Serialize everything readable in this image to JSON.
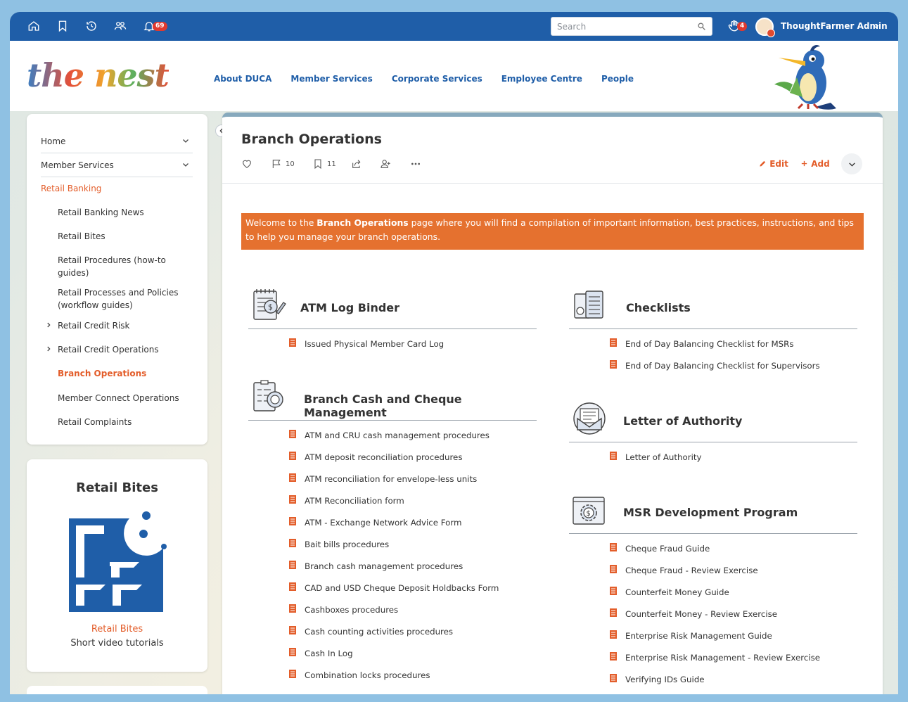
{
  "topbar": {
    "notifications_count": "69",
    "high_five_count": "4",
    "search_placeholder": "Search",
    "user_name": "ThoughtFarmer Admin"
  },
  "header": {
    "logo_text": "the nest",
    "nav": [
      "About DUCA",
      "Member Services",
      "Corporate Services",
      "Employee Centre",
      "People"
    ]
  },
  "sidebar": {
    "top_items": [
      "Home",
      "Member Services"
    ],
    "active_item": "Retail Banking",
    "sub_items": [
      {
        "label": "Retail Banking News",
        "arrow": false
      },
      {
        "label": "Retail Bites",
        "arrow": false
      },
      {
        "label": "Retail Procedures (how-to guides)",
        "arrow": false
      },
      {
        "label": "Retail Processes and Policies (workflow guides)",
        "arrow": false
      },
      {
        "label": "Retail Credit Risk",
        "arrow": true
      },
      {
        "label": "Retail Credit Operations",
        "arrow": true
      },
      {
        "label": "Branch Operations",
        "arrow": false
      },
      {
        "label": "Member Connect Operations",
        "arrow": false
      },
      {
        "label": "Retail Complaints",
        "arrow": false
      }
    ]
  },
  "retail_bites_card": {
    "title": "Retail Bites",
    "link": "Retail Bites",
    "subtitle": "Short video tutorials"
  },
  "main": {
    "title": "Branch Operations",
    "comments_count": "10",
    "bookmarks_count": "11",
    "edit_label": "Edit",
    "add_label": "Add",
    "banner_pre": "Welcome to the ",
    "banner_bold": "Branch Operations",
    "banner_post": " page where you will find a compilation of important information, best practices, instructions, and tips to help you manage your branch operations."
  },
  "sections_left": [
    {
      "title": "ATM Log Binder",
      "items": [
        "Issued Physical Member Card Log"
      ]
    },
    {
      "title": "Branch Cash and Cheque Management",
      "items": [
        "ATM and CRU cash management procedures",
        "ATM deposit reconciliation procedures",
        "ATM reconciliation for envelope-less units",
        "ATM Reconciliation form",
        "ATM - Exchange Network Advice Form",
        "Bait bills procedures",
        "Branch cash management procedures",
        "CAD and USD Cheque Deposit Holdbacks Form",
        "Cashboxes procedures",
        "Cash counting activities procedures",
        "Cash In Log",
        "Combination locks procedures"
      ]
    }
  ],
  "sections_right": [
    {
      "title": "Checklists",
      "items": [
        "End of Day Balancing Checklist for MSRs",
        "End of Day Balancing Checklist for Supervisors"
      ]
    },
    {
      "title": "Letter of Authority",
      "items": [
        "Letter of Authority"
      ]
    },
    {
      "title": "MSR Development Program",
      "items": [
        "Cheque Fraud Guide",
        "Cheque Fraud - Review Exercise",
        "Counterfeit Money Guide",
        "Counterfeit Money - Review Exercise",
        "Enterprise Risk Management Guide",
        "Enterprise Risk Management - Review Exercise",
        "Verifying IDs Guide"
      ]
    }
  ],
  "colors": {
    "topbar": "#1f5ea8",
    "accent": "#e35d2a",
    "banner": "#e5712f"
  }
}
